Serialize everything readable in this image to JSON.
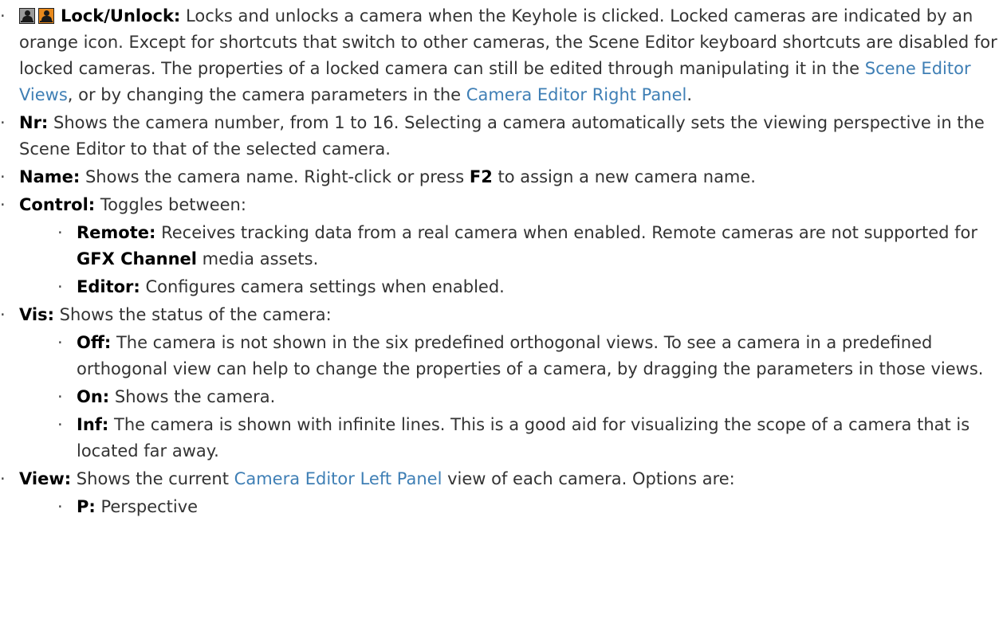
{
  "bullet": "·",
  "icons": [
    "camera-unlocked-icon",
    "camera-locked-icon"
  ],
  "colors": {
    "link": "#3f7fb5",
    "locked_icon": "#e8891c",
    "unlocked_icon": "#9a9a9a"
  },
  "lock": {
    "term": "Lock/Unlock:",
    "text1": " Locks and unlocks a camera when the Keyhole is clicked. Locked cameras are indicated by an orange icon. Except for shortcuts that switch to other cameras, the Scene Editor keyboard shortcuts are disabled for locked cameras. The properties of a locked camera can still be edited through manipulating it in the ",
    "link1": "Scene Editor Views",
    "text2": ", or by changing the camera parameters in the ",
    "link2": "Camera Editor Right Panel",
    "text3": "."
  },
  "nr": {
    "term": "Nr:",
    "text": " Shows the camera number, from 1 to 16. Selecting a camera automatically sets the viewing perspective in the Scene Editor to that of the selected camera."
  },
  "name": {
    "term": "Name:",
    "text1": " Shows the camera name. Right-click or press ",
    "key": "F2",
    "text2": " to assign a new camera name."
  },
  "control": {
    "term": "Control:",
    "text": " Toggles between:",
    "remote": {
      "term": "Remote:",
      "text1": " Receives tracking data from a real camera when enabled. Remote cameras are not supported for ",
      "bold": "GFX Channel",
      "text2": " media assets."
    },
    "editor": {
      "term": "Editor:",
      "text": " Configures camera settings when enabled."
    }
  },
  "vis": {
    "term": "Vis:",
    "text": " Shows the status of the camera:",
    "off": {
      "term": "Off:",
      "text": " The camera is not shown in the six predefined orthogonal views. To see a camera in a predefined orthogonal view can help to change the properties of a camera, by dragging the parameters in those views."
    },
    "on": {
      "term": "On:",
      "text": " Shows the camera."
    },
    "inf": {
      "term": "Inf:",
      "text": " The camera is shown with infinite lines. This is a good aid for visualizing the scope of a camera that is located far away."
    }
  },
  "view": {
    "term": "View:",
    "text1": " Shows the current ",
    "link": "Camera Editor Left Panel",
    "text2": " view of each camera. Options are:",
    "p": {
      "term": "P:",
      "text": " Perspective"
    }
  }
}
